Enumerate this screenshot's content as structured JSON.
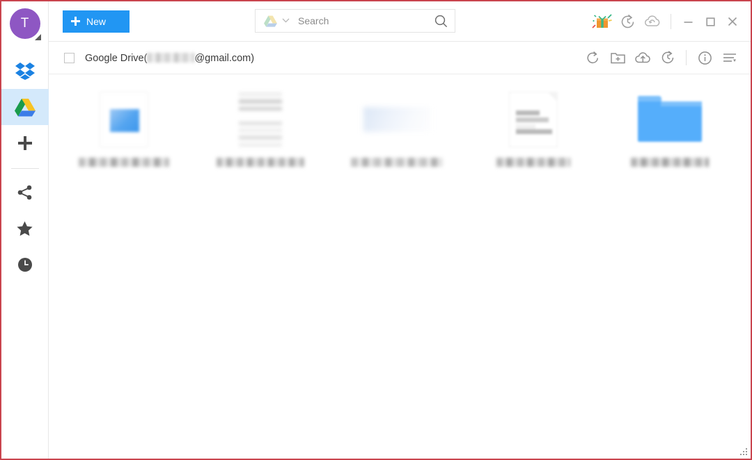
{
  "app": {
    "accent_blue": "#2196f3",
    "window_border": "#c9444e",
    "selected_rail_bg": "#d4e9fb",
    "avatar_bg": "#8e57c3",
    "folder_blue": "#55aefb"
  },
  "sidebar": {
    "avatar": {
      "initial": "T",
      "name": "user-avatar"
    },
    "items": [
      {
        "name": "sidebar-item-dropbox",
        "label": "Dropbox",
        "icon": "dropbox-icon",
        "active": false
      },
      {
        "name": "sidebar-item-google-drive",
        "label": "Google Drive",
        "icon": "google-drive-icon",
        "active": true
      },
      {
        "name": "sidebar-item-add-cloud",
        "label": "Add Cloud",
        "icon": "plus-icon",
        "active": false
      },
      {
        "name": "sidebar-item-shared",
        "label": "Shared",
        "icon": "share-icon",
        "active": false
      },
      {
        "name": "sidebar-item-starred",
        "label": "Starred",
        "icon": "star-icon",
        "active": false
      },
      {
        "name": "sidebar-item-recent",
        "label": "Recent",
        "icon": "clock-icon",
        "active": false
      }
    ]
  },
  "toolbar": {
    "new_label": "New",
    "search": {
      "placeholder": "Search",
      "value": "",
      "scope_icon": "google-drive-icon",
      "caret_glyph": "∨",
      "search_icon": "search-icon"
    },
    "right_icons": [
      {
        "name": "gift-icon",
        "label": "Gift"
      },
      {
        "name": "history-icon",
        "label": "Transfer History"
      },
      {
        "name": "cloud-sync-icon",
        "label": "Cloud Sync"
      }
    ],
    "window_controls": [
      {
        "name": "minimize-button",
        "glyph": "—"
      },
      {
        "name": "maximize-button",
        "glyph": "□"
      },
      {
        "name": "close-button",
        "glyph": "✕"
      }
    ]
  },
  "account_bar": {
    "checkbox_checked": false,
    "label_prefix": "Google Drive(",
    "label_suffix": "@gmail.com)",
    "email_redacted": true,
    "tools": [
      {
        "name": "refresh-icon",
        "label": "Refresh"
      },
      {
        "name": "new-folder-icon",
        "label": "New Folder"
      },
      {
        "name": "upload-icon",
        "label": "Upload"
      },
      {
        "name": "sync-history-icon",
        "label": "Sync History"
      },
      {
        "name": "info-icon",
        "label": "Details"
      },
      {
        "name": "list-menu-icon",
        "label": "View Options"
      }
    ]
  },
  "files": {
    "items": [
      {
        "name": "file-item-1",
        "type": "image-document",
        "label_redacted": true,
        "label_width": 130
      },
      {
        "name": "file-item-2",
        "type": "text-document",
        "label_redacted": true,
        "label_width": 126
      },
      {
        "name": "file-item-3",
        "type": "faint-document",
        "label_redacted": true,
        "label_width": 132
      },
      {
        "name": "file-item-4",
        "type": "page-document",
        "label_redacted": true,
        "label_width": 106
      },
      {
        "name": "file-item-5",
        "type": "folder",
        "label_redacted": true,
        "label_width": 112
      }
    ]
  },
  "status": {
    "resize_grip": "resize-grip"
  }
}
